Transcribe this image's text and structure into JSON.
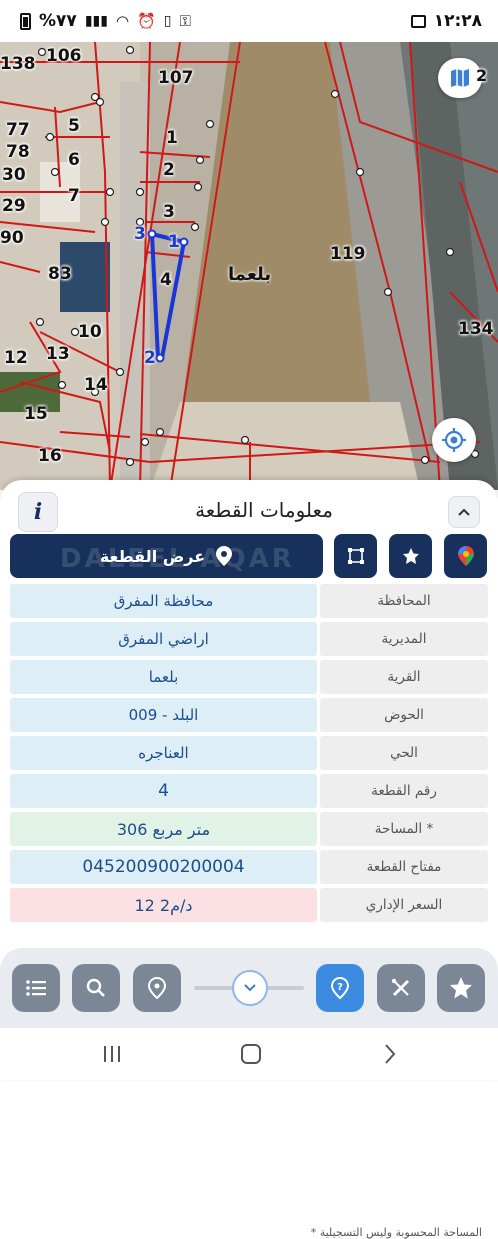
{
  "status_bar": {
    "time": "١٢:٢٨",
    "battery": "%٧٧"
  },
  "map": {
    "village_label": "بلعما",
    "parcel_numbers": [
      "138",
      "106",
      "107",
      "77",
      "78",
      "30",
      "29",
      "90",
      "5",
      "6",
      "7",
      "1",
      "2",
      "3",
      "83",
      "10",
      "12",
      "13",
      "14",
      "15",
      "16",
      "119",
      "134",
      "2"
    ],
    "pins": [
      "1",
      "2",
      "3"
    ],
    "selected_parcel": "4",
    "layers_badge": "2"
  },
  "sheet": {
    "title": "معلومات القطعة",
    "info_icon": "i",
    "show_plot_label": "عرض القطعة",
    "watermark": "DALEEL AQAR",
    "rows": [
      {
        "key": "المحافظة",
        "value": "محافظة المفرق",
        "tone": "#deeef6"
      },
      {
        "key": "المديرية",
        "value": "اراضي المفرق",
        "tone": "#deeef6"
      },
      {
        "key": "القرية",
        "value": "بلعما",
        "tone": "#deeef6"
      },
      {
        "key": "الحوض",
        "value": "البلد - 009",
        "tone": "#deeef6"
      },
      {
        "key": "الحي",
        "value": "العناجره",
        "tone": "#deeef6"
      },
      {
        "key": "رقم القطعة",
        "value": "4",
        "tone": "#deeef6"
      },
      {
        "key": "المساحة *",
        "value": "306  متر مربع",
        "tone": "#e1f3e6"
      },
      {
        "key": "مفتاح القطعة",
        "value": "045200900200004",
        "tone": "#deeef6"
      },
      {
        "key": "السعر الإداري",
        "value": "12 د/م2",
        "tone": "#fbe1e3"
      }
    ],
    "footnote": "* المساحة المحسوبة وليس التسجيلية"
  },
  "toolbar": {
    "icons": [
      "list-icon",
      "search-icon",
      "location-pin-icon",
      "chevron-down-icon",
      "help-pin-icon",
      "measure-icon",
      "star-icon"
    ]
  },
  "colors": {
    "navy": "#17315c",
    "accent_blue": "#3d7fd1",
    "parcel_line": "#d01818",
    "selected_line": "#1a35d8"
  }
}
